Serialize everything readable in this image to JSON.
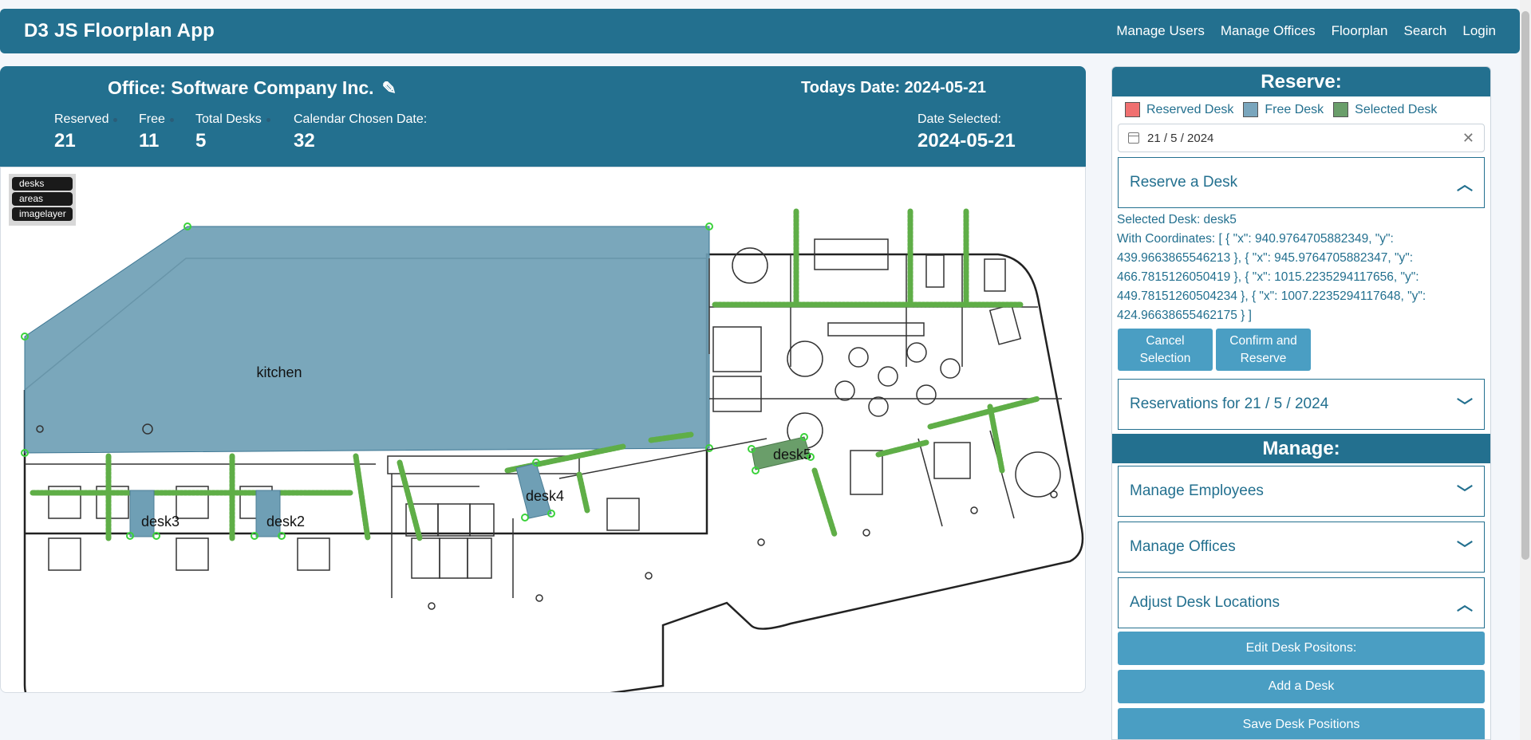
{
  "app": {
    "title": "D3 JS Floorplan App"
  },
  "nav": {
    "items": [
      "Manage Users",
      "Manage Offices",
      "Floorplan",
      "Search",
      "Login"
    ]
  },
  "office": {
    "title": "Office: Software Company Inc.",
    "edit_icon": "pencil-icon",
    "todays_date": "Todays Date: 2024-05-21",
    "stats": [
      {
        "label": "Reserved",
        "value": "21"
      },
      {
        "label": "Free",
        "value": "11"
      },
      {
        "label": "Total Desks",
        "value": "5"
      },
      {
        "label": "Calendar Chosen Date:",
        "value": "32"
      }
    ],
    "date_selected_label": "Date Selected:",
    "date_selected_value": "2024-05-21"
  },
  "floorplan": {
    "layers": [
      "desks",
      "areas",
      "imagelayer"
    ],
    "areas": [
      {
        "label": "kitchen"
      }
    ],
    "desks": [
      {
        "label": "desk3",
        "status": "free"
      },
      {
        "label": "desk2",
        "status": "free"
      },
      {
        "label": "desk4",
        "status": "free"
      },
      {
        "label": "desk5",
        "status": "selected"
      }
    ]
  },
  "reserve": {
    "heading": "Reserve:",
    "legend": [
      {
        "label": "Reserved Desk",
        "color": "#f07070"
      },
      {
        "label": "Free Desk",
        "color": "#7aa6bd"
      },
      {
        "label": "Selected Desk",
        "color": "#6a9e6a"
      }
    ],
    "date_value": "21 / 5 / 2024",
    "reserve_accordion": "Reserve a Desk",
    "selected_desk": "Selected Desk: desk5",
    "coordinates_lines": [
      "With Coordinates: [ { \"x\": 940.9764705882349, \"y\":",
      "439.9663865546213 }, { \"x\": 945.9764705882347, \"y\":",
      "466.7815126050419 }, { \"x\": 1015.2235294117656, \"y\":",
      "449.78151260504234 }, { \"x\": 1007.2235294117648, \"y\":",
      "424.96638655462175 } ]"
    ],
    "cancel_line1": "Cancel",
    "cancel_line2": "Selection",
    "confirm_line1": "Confirm and",
    "confirm_line2": "Reserve",
    "reservations_accordion": "Reservations for 21 / 5 / 2024"
  },
  "manage": {
    "heading": "Manage:",
    "employees": "Manage Employees",
    "offices": "Manage Offices",
    "adjust": "Adjust Desk Locations",
    "edit_positions": "Edit Desk Positons:",
    "add_desk": "Add a Desk",
    "save_positions": "Save Desk Positions"
  }
}
